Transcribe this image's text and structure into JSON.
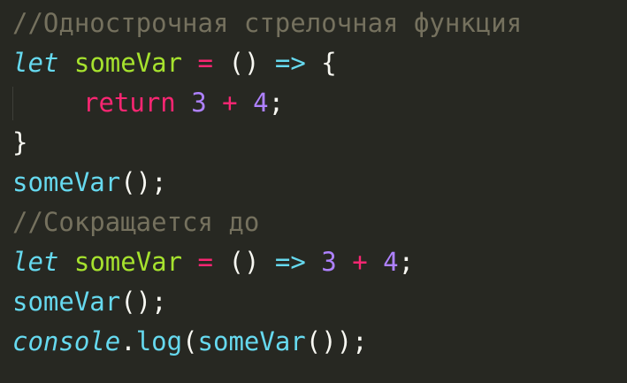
{
  "code": {
    "line1": {
      "comment": "//Однострочная стрелочная функция"
    },
    "line2": {
      "kw": "let",
      "var": "someVar",
      "eq": "=",
      "parens": "()",
      "arrow": "=>",
      "brace": "{"
    },
    "line3": {
      "ret": "return",
      "n1": "3",
      "plus": "+",
      "n2": "4",
      "semi": ";"
    },
    "line4": {
      "brace": "}"
    },
    "line5": {
      "call": "someVar",
      "rest": "();"
    },
    "line6": {
      "comment": "//Сокращается до"
    },
    "line7": {
      "kw": "let",
      "var": "someVar",
      "eq": "=",
      "parens": "()",
      "arrow": "=>",
      "n1": "3",
      "plus": "+",
      "n2": "4",
      "semi": ";"
    },
    "line8": {
      "call": "someVar",
      "rest": "();"
    },
    "line9": {
      "obj": "console",
      "dot": ".",
      "method": "log",
      "open": "(",
      "call": "someVar",
      "inner": "()",
      "close": ");"
    }
  },
  "theme": {
    "background": "#272822",
    "comment": "#75715E",
    "keyword": "#66D9EF",
    "variable": "#A6E22E",
    "operator": "#F92672",
    "number": "#AE81FF",
    "text": "#F8F8F2"
  }
}
